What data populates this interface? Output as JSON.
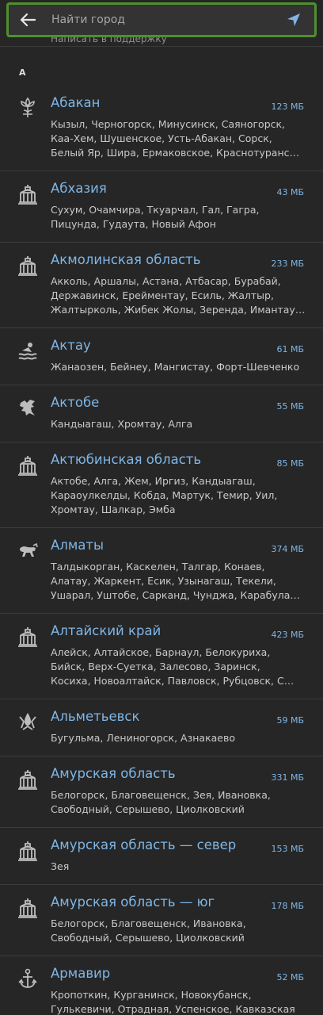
{
  "search": {
    "placeholder": "Найти город",
    "behind_text": "Написать в поддержку"
  },
  "section": {
    "letter": "А"
  },
  "colors": {
    "accent_blue": "#7fb6e6",
    "search_border_green": "#4f8f2f",
    "background": "#262626"
  },
  "items": [
    {
      "name": "Абакан",
      "size": "123 МБ",
      "icon": "flower-emblem-icon",
      "lines": [
        "Кызыл, Черногорск, Минусинск, Саяногорск,",
        "Каа-Хем, Шушенское, Усть-Абакан, Сорск,",
        "Белый Яр, Шира, Ермаковское, Краснотуранс…"
      ]
    },
    {
      "name": "Абхазия",
      "size": "43 МБ",
      "icon": "government-building-icon",
      "lines": [
        "Сухум, Очамчира, Ткуарчал, Гал, Гагра,",
        "Пицунда, Гудаута, Новый Афон"
      ]
    },
    {
      "name": "Акмолинская область",
      "size": "233 МБ",
      "icon": "government-building-icon",
      "lines": [
        "Акколь, Аршалы, Астана, Атбасар, Бурабай,",
        "Державинск, Ерейментау, Есиль, Жалтыр,",
        "Жалтырколь, Жибек Жолы, Зеренда, Имантау…"
      ]
    },
    {
      "name": "Актау",
      "size": "61 МБ",
      "icon": "sea-emblem-icon",
      "lines": [
        "Жанаозен, Бейнеу, Мангистау, Форт-Шевченко"
      ]
    },
    {
      "name": "Актобе",
      "size": "55 МБ",
      "icon": "griffin-emblem-icon",
      "lines": [
        "Кандыагаш, Хромтау, Алга"
      ]
    },
    {
      "name": "Актюбинская область",
      "size": "85 МБ",
      "icon": "government-building-icon",
      "lines": [
        "Актобе, Алга, Жем, Иргиз, Кандыагаш,",
        "Караоулкелды, Кобда, Мартук, Темир, Уил,",
        "Хромтау, Шалкар, Эмба"
      ]
    },
    {
      "name": "Алматы",
      "size": "374 МБ",
      "icon": "snow-leopard-emblem-icon",
      "lines": [
        "Талдыкорган, Каскелен, Талгар, Конаев,",
        "Алатау, Жаркент, Есик, Узынагаш, Текели,",
        "Ушарал, Уштобе, Сарканд, Чунджа, Карабула…"
      ]
    },
    {
      "name": "Алтайский край",
      "size": "423 МБ",
      "icon": "government-building-icon",
      "lines": [
        "Алейск, Алтайское, Барнаул, Белокуриха,",
        "Бийск, Верх-Суетка, Залесово, Заринск,",
        "Косиха, Новоалтайск, Павловск, Рубцовск, С…"
      ]
    },
    {
      "name": "Альметьевск",
      "size": "59 МБ",
      "icon": "oil-drop-emblem-icon",
      "lines": [
        "Бугульма, Лениногорск, Азнакаево"
      ]
    },
    {
      "name": "Амурская область",
      "size": "331 МБ",
      "icon": "government-building-icon",
      "lines": [
        "Белогорск, Благовещенск, Зея, Ивановка,",
        "Свободный, Серышево, Циолковский"
      ]
    },
    {
      "name": "Амурская область — север",
      "size": "153 МБ",
      "icon": "government-building-icon",
      "lines": [
        "Зея"
      ]
    },
    {
      "name": "Амурская область — юг",
      "size": "178 МБ",
      "icon": "government-building-icon",
      "lines": [
        "Белогорск, Благовещенск, Ивановка,",
        "Свободный, Серышево, Циолковский"
      ]
    },
    {
      "name": "Армавир",
      "size": "52 МБ",
      "icon": "anchor-emblem-icon",
      "lines": [
        "Кропоткин, Курганинск, Новокубанск,",
        "Гулькевичи, Отрадная, Успенское, Кавказская"
      ]
    }
  ]
}
